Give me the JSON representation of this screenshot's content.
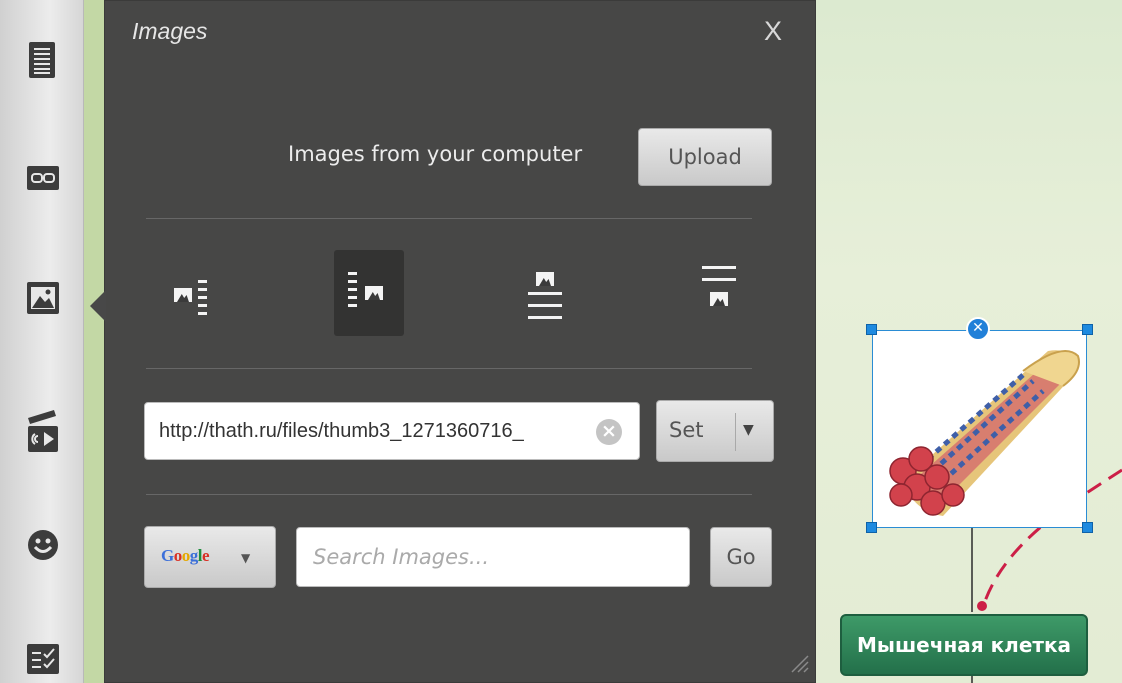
{
  "panel": {
    "title": "Images",
    "close_label": "X",
    "upload_label": "Images from your computer",
    "upload_button": "Upload",
    "layout_options": [
      "image-left-text-right",
      "text-left-image-right",
      "image-top-text-below",
      "text-top-image-below"
    ],
    "selected_layout": "text-left-image-right",
    "url_value": "http://thath.ru/files/thumb3_1271360716_",
    "set_button": "Set",
    "search_engine": "Google",
    "search_placeholder": "Search Images...",
    "go_button": "Go"
  },
  "toolbar": {
    "icons": [
      "notes-icon",
      "link-icon",
      "image-icon",
      "video-icon",
      "smiley-icon",
      "task-icon"
    ]
  },
  "canvas": {
    "node_label": "Мышечная клетка",
    "image_subject": "muscle-fiber",
    "colors": {
      "accent": "#2a8cd4",
      "link": "#cc1f47",
      "node": "#2f8256"
    }
  }
}
